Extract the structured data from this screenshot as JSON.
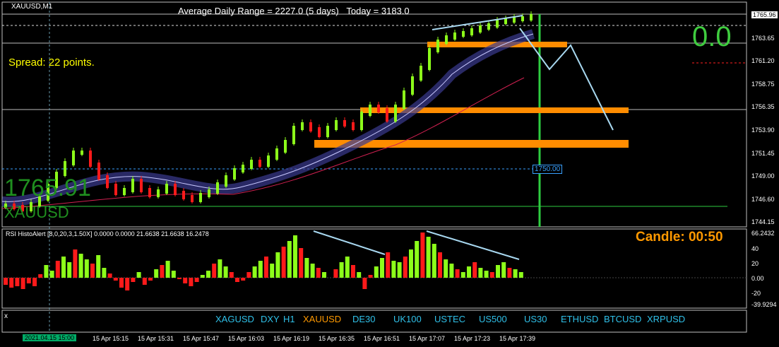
{
  "chart": {
    "symbol_label": "XAUUSD,M1",
    "avg_range_text": "Average Daily Range = 2227.0 (5 days)",
    "today_text": "Today = 3183.0",
    "spread_text": "Spread: 22 points.",
    "big_value": "0.0",
    "watermark_price": "1765.91",
    "watermark_symbol": "XAUUSD",
    "level_label": "1750.00"
  },
  "price_axis": [
    "1765.96",
    "1763.65",
    "1761.20",
    "1758.75",
    "1756.35",
    "1753.90",
    "1751.45",
    "1749.00",
    "1746.60",
    "1744.15"
  ],
  "indicator": {
    "label": "RSI HistoAlert [8,0,20,3,1.50X] 0.0000 0.0000 21.6638 21.6638 16.2478",
    "candle_timer": "Candle:  00:50",
    "axis": [
      "66.2432",
      "40",
      "20",
      "0.00",
      "-20",
      "-39.9294"
    ]
  },
  "time_axis": {
    "current": "2021.04.15 15:00",
    "labels": [
      "15 Apr 15:15",
      "15 Apr 15:31",
      "15 Apr 15:47",
      "15 Apr 16:03",
      "15 Apr 16:19",
      "15 Apr 16:35",
      "15 Apr 16:51",
      "15 Apr 17:07",
      "15 Apr 17:23",
      "15 Apr 17:39"
    ]
  },
  "symbols": [
    "XAGUSD",
    "DXY",
    "H1",
    "XAUUSD",
    "DE30",
    "UK100",
    "USTEC",
    "US500",
    "US30",
    "ETHUSD",
    "BTCUSD",
    "XRPUSD"
  ],
  "active_symbol": "XAUUSD",
  "colors": {
    "bull": "#8dff1a",
    "bear": "#ff1a1a",
    "level": "#ff8c00",
    "trend": "#a8d8f0",
    "vline": "#2ecc40"
  }
}
